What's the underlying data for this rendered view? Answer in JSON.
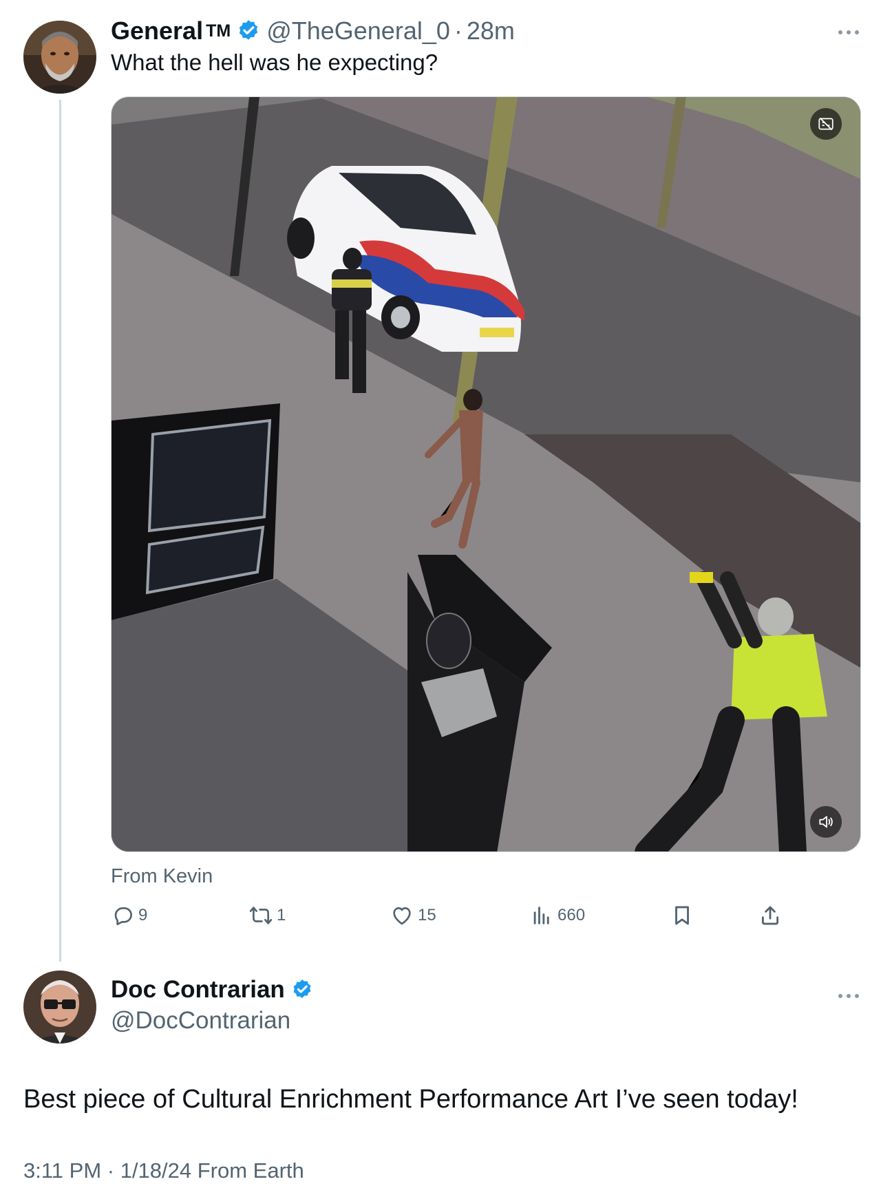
{
  "tweet": {
    "author_name": "General",
    "author_tm": "TM",
    "author_handle": "@TheGeneral_0",
    "separator": "·",
    "time_ago": "28m",
    "text": "What the hell was he expecting?",
    "from_line": "From Kevin",
    "media": {
      "type": "video",
      "description_icon": "captions-off-icon",
      "sound_icon": "speaker-icon"
    },
    "actions": {
      "replies": "9",
      "reposts": "1",
      "likes": "15",
      "views": "660"
    }
  },
  "reply": {
    "author_name": "Doc Contrarian",
    "author_handle": "@DocContrarian",
    "text": "Best piece of Cultural Enrichment Performance Art I’ve seen today!",
    "timestamp": "3:11 PM · 1/18/24 From Earth"
  },
  "colors": {
    "verified_blue": "#1d9bf0",
    "secondary_text": "#536471",
    "primary_text": "#0f1419",
    "thread_line": "#cfd9de"
  }
}
